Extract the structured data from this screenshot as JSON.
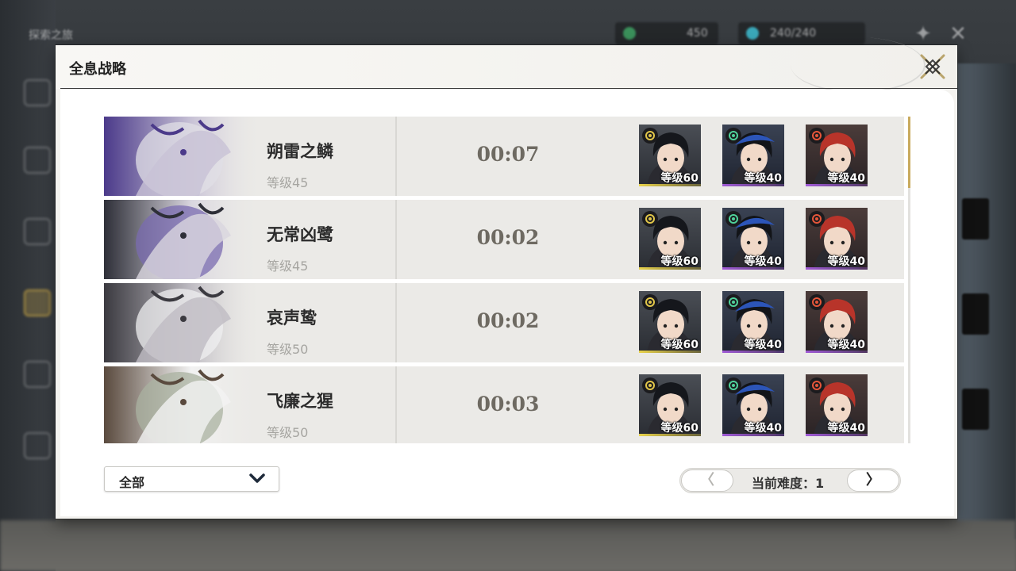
{
  "background": {
    "hud_title": "探索之旅",
    "currency_1": "450",
    "currency_2": "240/240",
    "currency_1_color": "#3a8f5a",
    "currency_2_color": "#3aa7b8"
  },
  "modal": {
    "title": "全息战略"
  },
  "bosses": [
    {
      "name": "朔雷之鳞",
      "level": "等级45",
      "time": "00:07",
      "palette": [
        "#4b3a8a",
        "#c8c2d6",
        "#e0dfe6"
      ],
      "team": [
        {
          "level": "等级60",
          "element": "spectro",
          "rarity_color": "#e8d24a"
        },
        {
          "level": "等级40",
          "element": "aero",
          "rarity_color": "#a05ad6"
        },
        {
          "level": "等级40",
          "element": "fusion",
          "rarity_color": "#a05ad6"
        }
      ]
    },
    {
      "name": "无常凶鹭",
      "level": "等级45",
      "time": "00:02",
      "palette": [
        "#2e2f38",
        "#d9d6df",
        "#7a6bb0"
      ],
      "team": [
        {
          "level": "等级60",
          "element": "spectro",
          "rarity_color": "#e8d24a"
        },
        {
          "level": "等级40",
          "element": "aero",
          "rarity_color": "#a05ad6"
        },
        {
          "level": "等级40",
          "element": "fusion",
          "rarity_color": "#a05ad6"
        }
      ]
    },
    {
      "name": "哀声鸷",
      "level": "等级50",
      "time": "00:02",
      "palette": [
        "#3b3a40",
        "#bfbcc3",
        "#efeff0"
      ],
      "team": [
        {
          "level": "等级60",
          "element": "spectro",
          "rarity_color": "#e8d24a"
        },
        {
          "level": "等级40",
          "element": "aero",
          "rarity_color": "#a05ad6"
        },
        {
          "level": "等级40",
          "element": "fusion",
          "rarity_color": "#a05ad6"
        }
      ]
    },
    {
      "name": "飞廉之猩",
      "level": "等级50",
      "time": "00:03",
      "palette": [
        "#5a4a3e",
        "#f2f2f2",
        "#a9b1a0"
      ],
      "team": [
        {
          "level": "等级60",
          "element": "spectro",
          "rarity_color": "#e8d24a"
        },
        {
          "level": "等级40",
          "element": "aero",
          "rarity_color": "#a05ad6"
        },
        {
          "level": "等级40",
          "element": "fusion",
          "rarity_color": "#a05ad6"
        }
      ]
    }
  ],
  "filter": {
    "selected": "全部"
  },
  "pager": {
    "prev": "〈",
    "next": "〉",
    "label": "当前难度：1"
  },
  "colors": {
    "accent_gold": "#c9aa5e",
    "spectro": "#e1c64a",
    "aero": "#4fd19a",
    "fusion": "#e4563a"
  }
}
